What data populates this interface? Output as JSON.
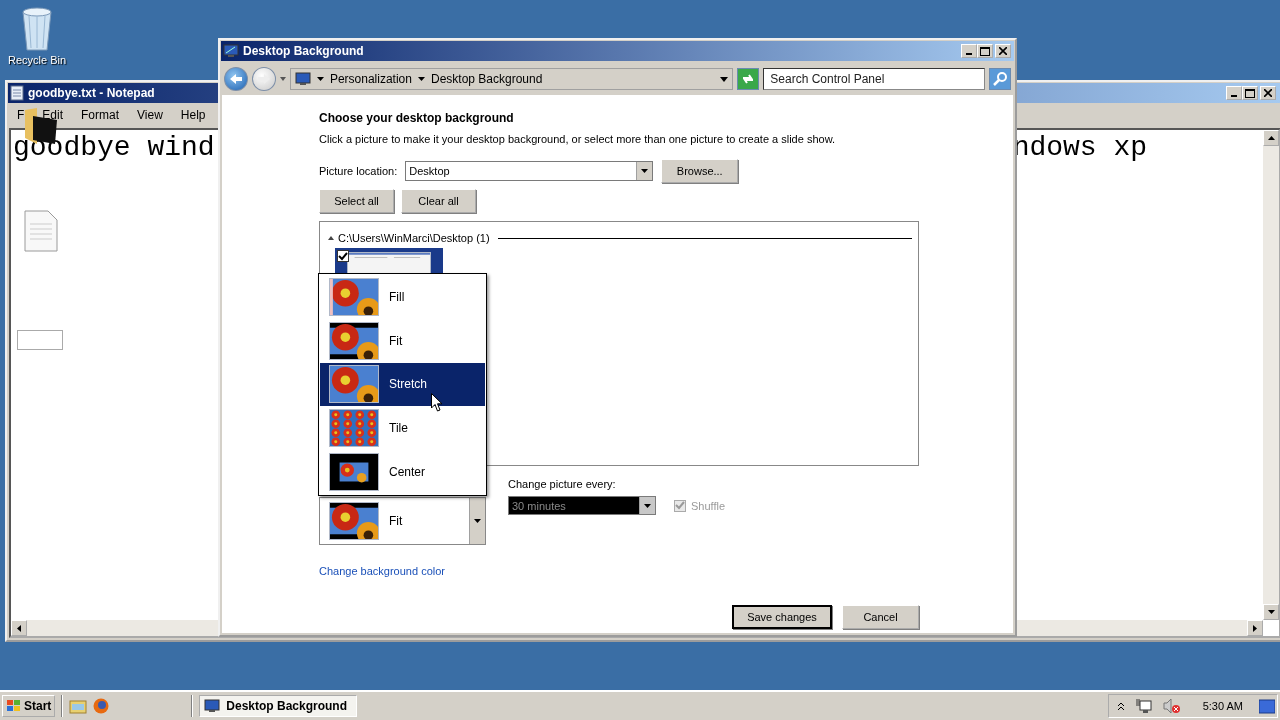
{
  "desktop": {
    "icons": [
      {
        "label": "Recycle Bin"
      }
    ]
  },
  "notepad": {
    "title": "goodbye.txt - Notepad",
    "menu": [
      {
        "label": "F"
      },
      {
        "label": "Edit"
      },
      {
        "label": "Format"
      },
      {
        "label": "View"
      },
      {
        "label": "Help"
      }
    ],
    "text_left": "goodbye wind",
    "text_right": "ndows xp"
  },
  "dialog": {
    "title": "Desktop Background",
    "address": {
      "breadcrumb": [
        "Personalization",
        "Desktop Background"
      ],
      "search": {
        "placeholder": "Search Control Panel"
      }
    },
    "heading": "Choose your desktop background",
    "description": "Click a picture to make it your desktop background, or select more than one picture to create a slide show.",
    "picture_location": {
      "label": "Picture location:",
      "value": "Desktop"
    },
    "browse_button": "Browse...",
    "select_all_button": "Select all",
    "clear_all_button": "Clear all",
    "group": {
      "label": "C:\\Users\\WinMarci\\Desktop (1)",
      "expanded": true,
      "pictures": [
        {
          "checked": true
        }
      ]
    },
    "position_menu": {
      "options": [
        {
          "label": "Fill",
          "kind": "fill",
          "selected": false
        },
        {
          "label": "Fit",
          "kind": "fit",
          "selected": false
        },
        {
          "label": "Stretch",
          "kind": "stretch",
          "selected": true
        },
        {
          "label": "Tile",
          "kind": "tile",
          "selected": false
        },
        {
          "label": "Center",
          "kind": "center",
          "selected": false
        }
      ]
    },
    "position_value": {
      "label": "Fit",
      "kind": "fit"
    },
    "change_picture": {
      "label": "Change picture every:",
      "value": "30 minutes",
      "disabled": true
    },
    "shuffle": {
      "label": "Shuffle",
      "checked": true,
      "disabled": true
    },
    "color_link": "Change background color",
    "buttons": [
      {
        "label": "Save changes",
        "default": true
      },
      {
        "label": "Cancel",
        "default": false
      }
    ]
  },
  "taskbar": {
    "start_label": "Start",
    "tasks": [
      {
        "label": "Desktop Background",
        "selected": true
      }
    ],
    "clock": "5:30 AM"
  }
}
